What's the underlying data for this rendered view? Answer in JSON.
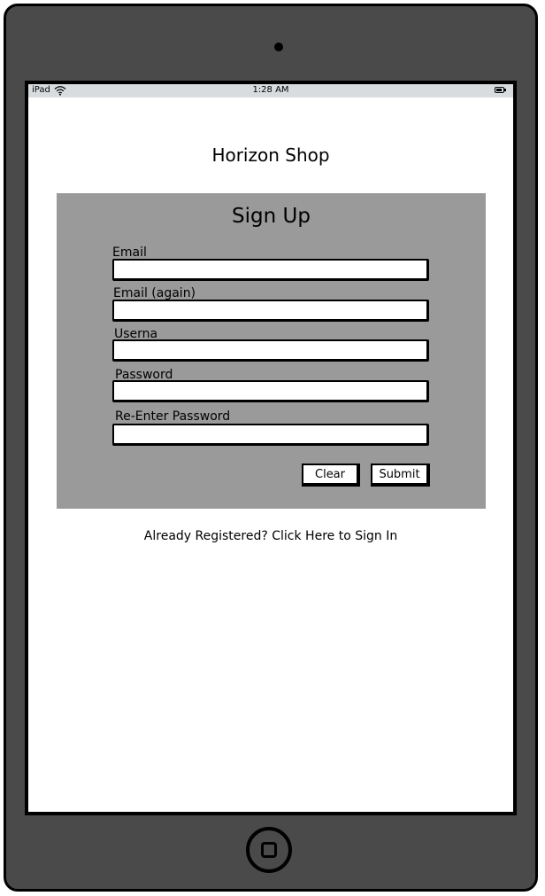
{
  "status_bar": {
    "device": "iPad",
    "time": "1:28 AM",
    "icons": [
      "wifi-icon",
      "battery-icon"
    ]
  },
  "app": {
    "title": "Horizon Shop"
  },
  "form": {
    "heading": "Sign Up",
    "fields": [
      {
        "label": "Email",
        "value": ""
      },
      {
        "label": "Email (again)",
        "value": ""
      },
      {
        "label": "Userna",
        "value": ""
      },
      {
        "label": "Password",
        "value": ""
      },
      {
        "label": "Re-Enter Password",
        "value": ""
      }
    ],
    "buttons": {
      "clear": "Clear",
      "submit": "Submit"
    }
  },
  "footer": {
    "signin_link": "Already Registered? Click Here to Sign In"
  },
  "colors": {
    "device_frame": "#4a4a4a",
    "status_bar": "#d9dcde",
    "panel": "#9a9a9a"
  }
}
